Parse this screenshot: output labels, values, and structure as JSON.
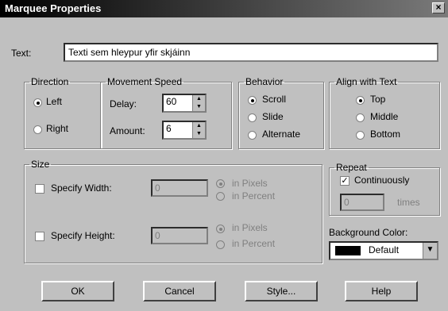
{
  "window": {
    "title": "Marquee Properties",
    "close": "×"
  },
  "text_field": {
    "label": "Text:",
    "value": "Texti sem hleypur yfir skjáinn"
  },
  "direction": {
    "legend": "Direction",
    "left": "Left",
    "right": "Right",
    "selected": "left"
  },
  "movement_speed": {
    "legend": "Movement Speed",
    "delay_label": "Delay:",
    "delay_value": "60",
    "amount_label": "Amount:",
    "amount_value": "6"
  },
  "behavior": {
    "legend": "Behavior",
    "scroll": "Scroll",
    "slide": "Slide",
    "alternate": "Alternate",
    "selected": "scroll"
  },
  "align": {
    "legend": "Align with Text",
    "top": "Top",
    "middle": "Middle",
    "bottom": "Bottom",
    "selected": "top"
  },
  "size": {
    "legend": "Size",
    "width_label": "Specify Width:",
    "width_value": "0",
    "height_label": "Specify Height:",
    "height_value": "0",
    "in_pixels": "in Pixels",
    "in_percent": "in Percent"
  },
  "repeat": {
    "legend": "Repeat",
    "continuously": "Continuously",
    "count_value": "0",
    "times": "times"
  },
  "background": {
    "label": "Background Color:",
    "value": "Default",
    "swatch_color": "#000000"
  },
  "buttons": {
    "ok": "OK",
    "cancel": "Cancel",
    "style": "Style...",
    "help": "Help"
  }
}
